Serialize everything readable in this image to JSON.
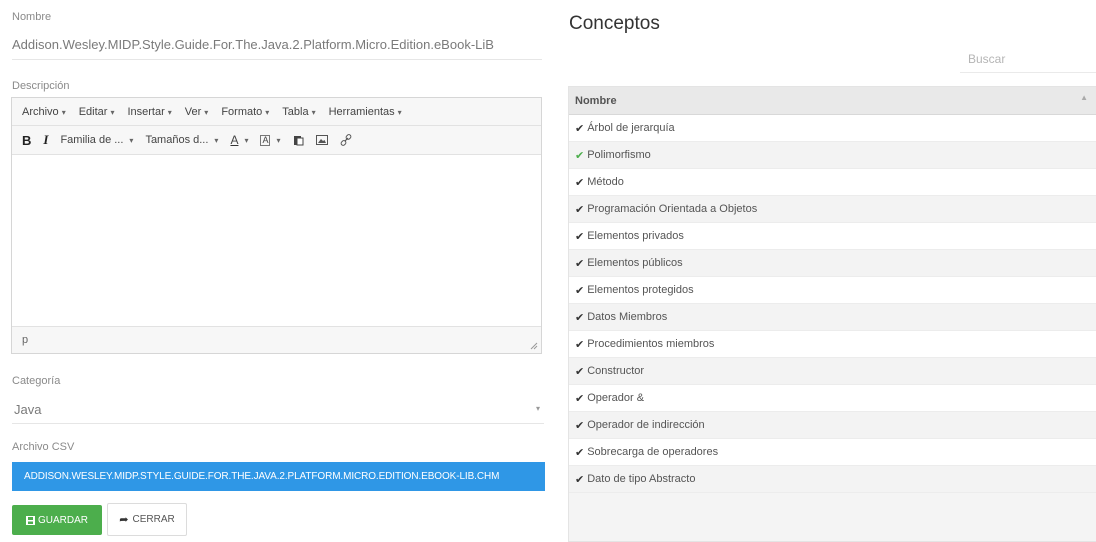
{
  "form": {
    "name_label": "Nombre",
    "name_value": "Addison.Wesley.MIDP.Style.Guide.For.The.Java.2.Platform.Micro.Edition.eBook-LiB",
    "description_label": "Descripción",
    "category_label": "Categoría",
    "category_value": "Java",
    "csv_label": "Archivo CSV",
    "csv_file": "ADDISON.WESLEY.MIDP.STYLE.GUIDE.FOR.THE.JAVA.2.PLATFORM.MICRO.EDITION.EBOOK-LIB.CHM",
    "save_label": "GUARDAR",
    "close_label": "CERRAR"
  },
  "editor": {
    "menus": [
      "Archivo",
      "Editar",
      "Insertar",
      "Ver",
      "Formato",
      "Tabla",
      "Herramientas"
    ],
    "font_family": "Familia de ...",
    "font_size": "Tamaños d...",
    "status_path": "p"
  },
  "concepts": {
    "title": "Conceptos",
    "search_placeholder": "Buscar",
    "column_header": "Nombre",
    "items": [
      "Árbol de jerarquía",
      "Polimorfismo",
      "Método",
      "Programación Orientada a Objetos",
      "Elementos privados",
      "Elementos públicos",
      "Elementos protegidos",
      "Datos Miembros",
      "Procedimientos miembros",
      "Constructor",
      "Operador &",
      "Operador de indirección",
      "Sobrecarga de operadores",
      "Dato de tipo Abstracto"
    ],
    "highlighted_item": "Polimorfismo"
  },
  "colors": {
    "save_button": "#4cae4c",
    "file_bar": "#2f97e6"
  }
}
